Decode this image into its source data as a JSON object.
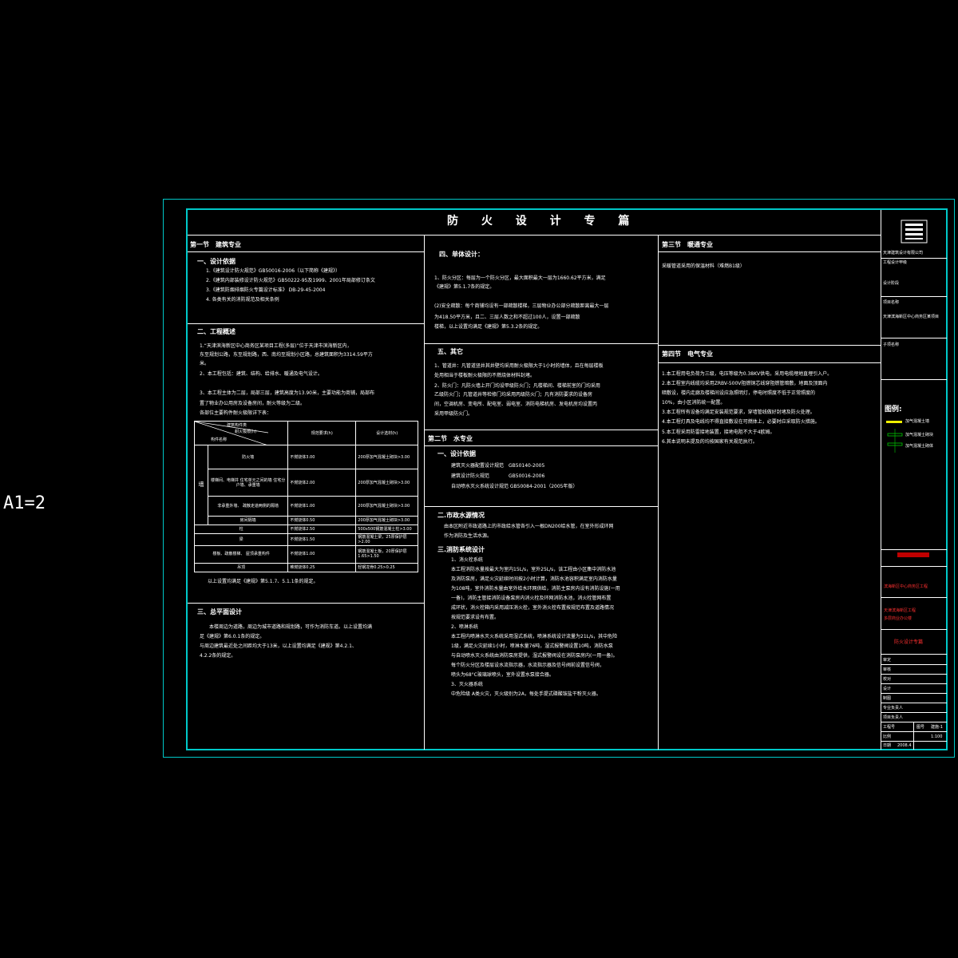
{
  "scale_label": "A1=2",
  "title": "防 火 设 计 专 篇",
  "col1": {
    "sec1_heading": "第一节　建筑专业",
    "s1_heading": "一、设计依据",
    "s1_lines": [
      "1.《建筑设计防火规范》GB50016-2006（以下简称《建规》）",
      "2.《建筑内部装修设计防火规范》GB50222-95及1999、2001年局部修订条文",
      "3.《建筑防烟排烟防火专篇设计标准》 DB-29-45-2004",
      "4. 各类有关的消防规范及相关条例"
    ],
    "s2_heading": "二、工程概述",
    "s2_lines": [
      "1.“天津滨海新区中心商务区某项目工程(多层)”位于天津市滨海新区内，",
      "  东至规划公路，东至规划路，西、南均至规划小区路，总建筑面积为3314.59平方",
      "  米。",
      "2、本工程包括：建筑、结构、给排水、暖通及电气设计。",
      "",
      "3、本工程主体为二层，局部三层，建筑高度为13.90米，主要功能为商铺，局部布",
      "  置了物业办公用房及设备房间，耐火等级为二级。",
      "  各部位主要构件耐火极限详下表："
    ],
    "table": {
      "header_diag_top": "建筑构件类",
      "header_diag_mid": "耐火极限(h)",
      "header_diag_bot": "构件名称",
      "col2": "规范要求(h)",
      "col3": "设计选材(h)",
      "group_label": "墙",
      "rows": [
        {
          "name": "防火墙",
          "req": "不燃烧体3.00",
          "design": "200厚加气混凝土砌块>3.00"
        },
        {
          "name": "楼梯间、电梯井 住宅单元之间的墙 住宅分户墙、承重墙",
          "req": "不燃烧体2.00",
          "design": "200厚加气混凝土砌块>3.00"
        },
        {
          "name": "非承重外墙、 疏散走道两侧的隔墙",
          "req": "不燃烧体1.00",
          "design": "200厚加气混凝土砌块>3.00"
        },
        {
          "name": "房间隔墙",
          "req": "不燃烧体0.50",
          "design": "200厚加气混凝土砌块>3.00"
        },
        {
          "name": "柱",
          "req": "不燃烧体2.50",
          "design": "500x500钢筋混凝土柱>3.00"
        },
        {
          "name": "梁",
          "req": "不燃烧体1.50",
          "design": "钢筋混凝土梁，25厚保护层>2.00"
        },
        {
          "name": "楼板、疏散楼梯、 屋顶承重构件",
          "req": "不燃烧体1.00",
          "design": "钢筋混凝土板，20厚保护层1.65>1.50"
        },
        {
          "name": "吊顶",
          "req": "难燃烧体0.25",
          "design": "轻钢龙骨0.25>0.25"
        }
      ]
    },
    "table_note": "以上设置均满足《建规》第5.1.7、5.1.1条的规定。",
    "s3_heading": "三、总平面设计",
    "s3_lines": [
      "本楼周边为道路，周边为城市道路和规划路，可作为消防车道。以上设置均满",
      "足《建规》第6.0.1条的规定。",
      "  与周边建筑最近处之间距均大于13米，以上设置均满足《建规》第4.2.1、",
      "4.2.2条的规定。"
    ]
  },
  "col2": {
    "s4_heading": "四、单体设计：",
    "s4_lines": [
      "1、防火分区：每层为一个防火分区，最大面积最大一层为1660.62平方米，满足",
      "  《建规》第5.1.7条的规定。",
      "",
      "(2)安全疏散：每个商铺均设有一部疏散楼梯，三层物业办公部分疏散距离最大一层",
      "  为418.50平方米，且二、三层人数之和不超过100人，设置一部疏散",
      "  楼梯，以上设置均满足《建规》第5.3.2条的规定。"
    ],
    "s5_heading": "五、其它",
    "s5_lines": [
      "1、管道井：凡管道竖井其井壁均采用耐火极限大于1小时的墙体，且在每层楼板",
      "  处用相当于楼板耐火极限的不燃烧体材料封堵。",
      "2、防火门：凡防火墙上开门均设甲级防火门；凡楼梯间、楼梯前室的门均采用",
      "  乙级防火门；凡管道井等检修门均采用丙级防火门；凡有消防要求的设备房",
      "  间，空调机房、变电所、配电室、弱电室、消防电梯机房、发电机房均设置丙",
      "  采用甲级防火门。"
    ],
    "sec2_heading": "第二节　水专业",
    "w1_heading": "一、设计依据",
    "w1_lines": [
      "建筑灭火器配置设计规范　GB50140-2005",
      "建筑设计防火规范　　　　GB50016-2006",
      "自动喷水灭火系统设计规范 GB50084-2001（2005年版）"
    ],
    "w2_heading": "二.市政水源情况",
    "w2_lines": [
      "  由本区附近市政道路上的市政给水管各引入一根DN200给水管，在室外形成环网",
      "  作为消防及生活水源。"
    ],
    "w3_heading": "三.消防系统设计",
    "w3_lines": [
      "1、消火栓系统",
      "本工程消防水量按最大为室内15L/s，室外25L/s，该工程由小区集中消防水池",
      "及消防泵房，满足火灾延续时间按2小时计算，消防水池容积满足室内消防水量",
      "为108吨，室外消防水量由室外给水环网供给，消防主泵房内设有消防设施(一用",
      "一备)，消防主管接消防设备泵房内消火栓及环网消防水池，消火栓管网布置",
      "成环状，消火栓箱内采用减压消火栓，室外消火栓布置按规范布置及道路情况",
      "按规范要求设有布置。",
      "2、喷淋系统",
      "本工程内喷淋水灭火系统采用湿式系统，喷淋系统设计流量为21L/s，其中危险",
      "1级，满足火灾延续1小时，喷淋水量76吨，湿式报警阀设置10吨，消防水泵",
      "与自动喷水灭火系统由消防泵房提供，湿式报警阀设在消防泵房内(一用一备)。",
      "每个防火分区及楼层设水流指示器，水流指示器及信号阀前设置信号阀，",
      "喷头为68°C玻璃球喷头，室外设置水泵接合器。",
      "3、灭火器系统",
      "中危险级 A类火灾，灭火级别为2A，每处手提式磷酸铵盐干粉灭火器。"
    ]
  },
  "col3": {
    "sec3_heading": "第三节　暖通专业",
    "hv_lines": [
      "采暖管道采用的保温材料（难燃B1级）"
    ],
    "sec4_heading": "第四节　电气专业",
    "el_lines": [
      "1.本工程用电负荷为三级，电压等级为0.38KV供电，采用电缆埋地直埋引入户。",
      "2.本工程室内线缆均采用ZRBV-500V阻燃铜芯线穿阻燃管暗敷，地面及顶面内",
      "  暗敷设，楼内走廊及楼梯间设应急照明灯，停电时照度不低于正常照度的",
      "  10%，由小区消防统一配置。",
      "3.本工程所有设备均满足安装规范要求，穿墙管线做好封堵及防火处理。",
      "4.本工程灯具及电线均不得直接敷设在可燃体上，必要时应采取防火措施。",
      "5.本工程采用防雷接地装置，接地电阻不大于4欧姆。",
      "6.其本说明未提及的均按国家有关规范执行。"
    ]
  },
  "title_block": {
    "company": "天津建筑设计有限公司",
    "company_sub": "工程设计甲级",
    "row_labels": [
      "设计阶段",
      "项目名称",
      "子项名称"
    ],
    "project_name": "天津滨海新区中心商务区某项目",
    "legend_title": "图例:",
    "legend_items": [
      "加气混凝土墙",
      "加气混凝土砌块",
      "加气混凝土砌体"
    ],
    "red_lines": [
      "滨海新区中心商务区工程",
      "天津滨海新区工程",
      "多层商业办公楼"
    ],
    "drawing_name": "防火设计专篇",
    "small_labels": [
      "审定",
      "审核",
      "校对",
      "设计",
      "制图",
      "专业负责人",
      "项目负责人",
      "工程号",
      "比例",
      "日期",
      "图号"
    ],
    "sheet_no": "建施-1",
    "scale": "1:100",
    "date": "2008.4"
  }
}
